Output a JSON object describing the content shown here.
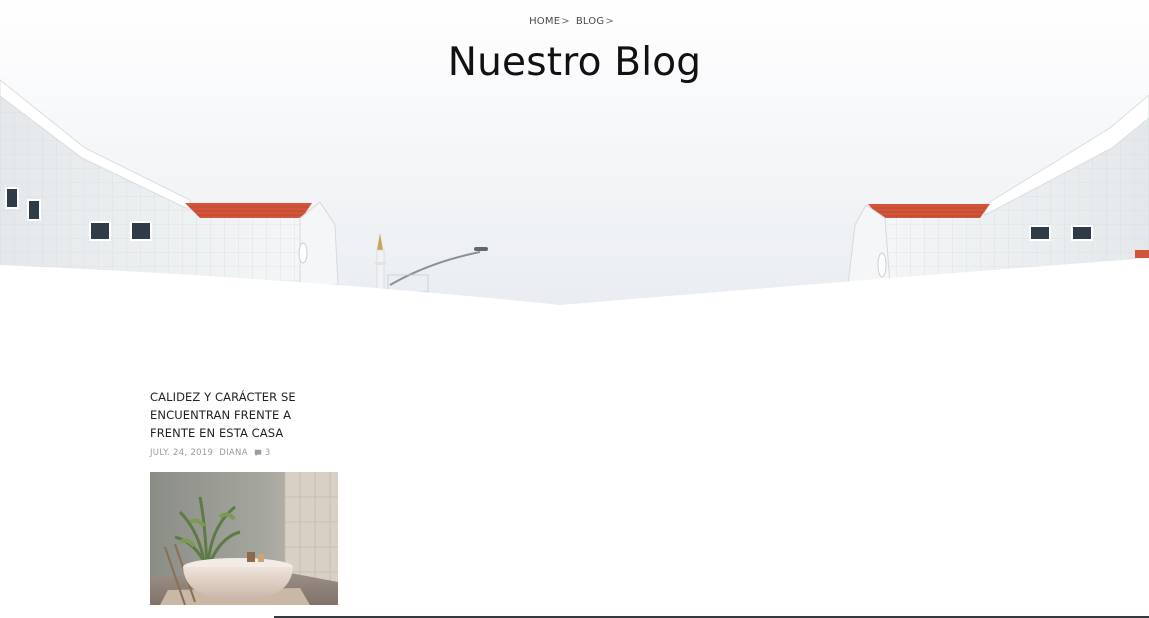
{
  "breadcrumb": {
    "items": [
      {
        "label": "HOME"
      },
      {
        "label": "BLOG"
      }
    ],
    "separator": ">"
  },
  "page": {
    "title": "Nuestro Blog"
  },
  "post": {
    "title": "CALIDEZ Y CARÁCTER SE ENCUENTRAN FRENTE A FRENTE EN ESTA CASA",
    "date": "JULY. 24, 2019",
    "author": "DIANA",
    "comments_count": "3",
    "comment_icon": "comment-icon",
    "thumbnail_icon": "bathroom-photo"
  },
  "colors": {
    "roof_red": "#d2553a",
    "wall_white": "#f2f4f5",
    "sky": "#eef1f4",
    "text_dark": "#111111",
    "meta_gray": "#9b9b9b"
  }
}
